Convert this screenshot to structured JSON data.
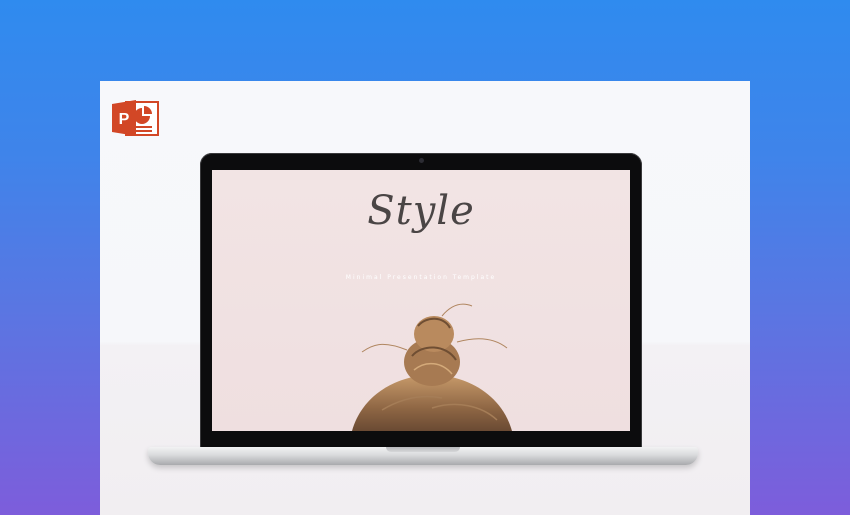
{
  "app": {
    "icon": "powerpoint-icon",
    "icon_letter": "P"
  },
  "slide": {
    "title": "Style",
    "subtitle": "Minimal Presentation Template"
  },
  "colors": {
    "background_top": "#2f8bef",
    "background_bottom": "#7d5ddb",
    "powerpoint_orange": "#d24726",
    "slide_background": "#f2e4e4",
    "title_color": "#4a4545"
  }
}
